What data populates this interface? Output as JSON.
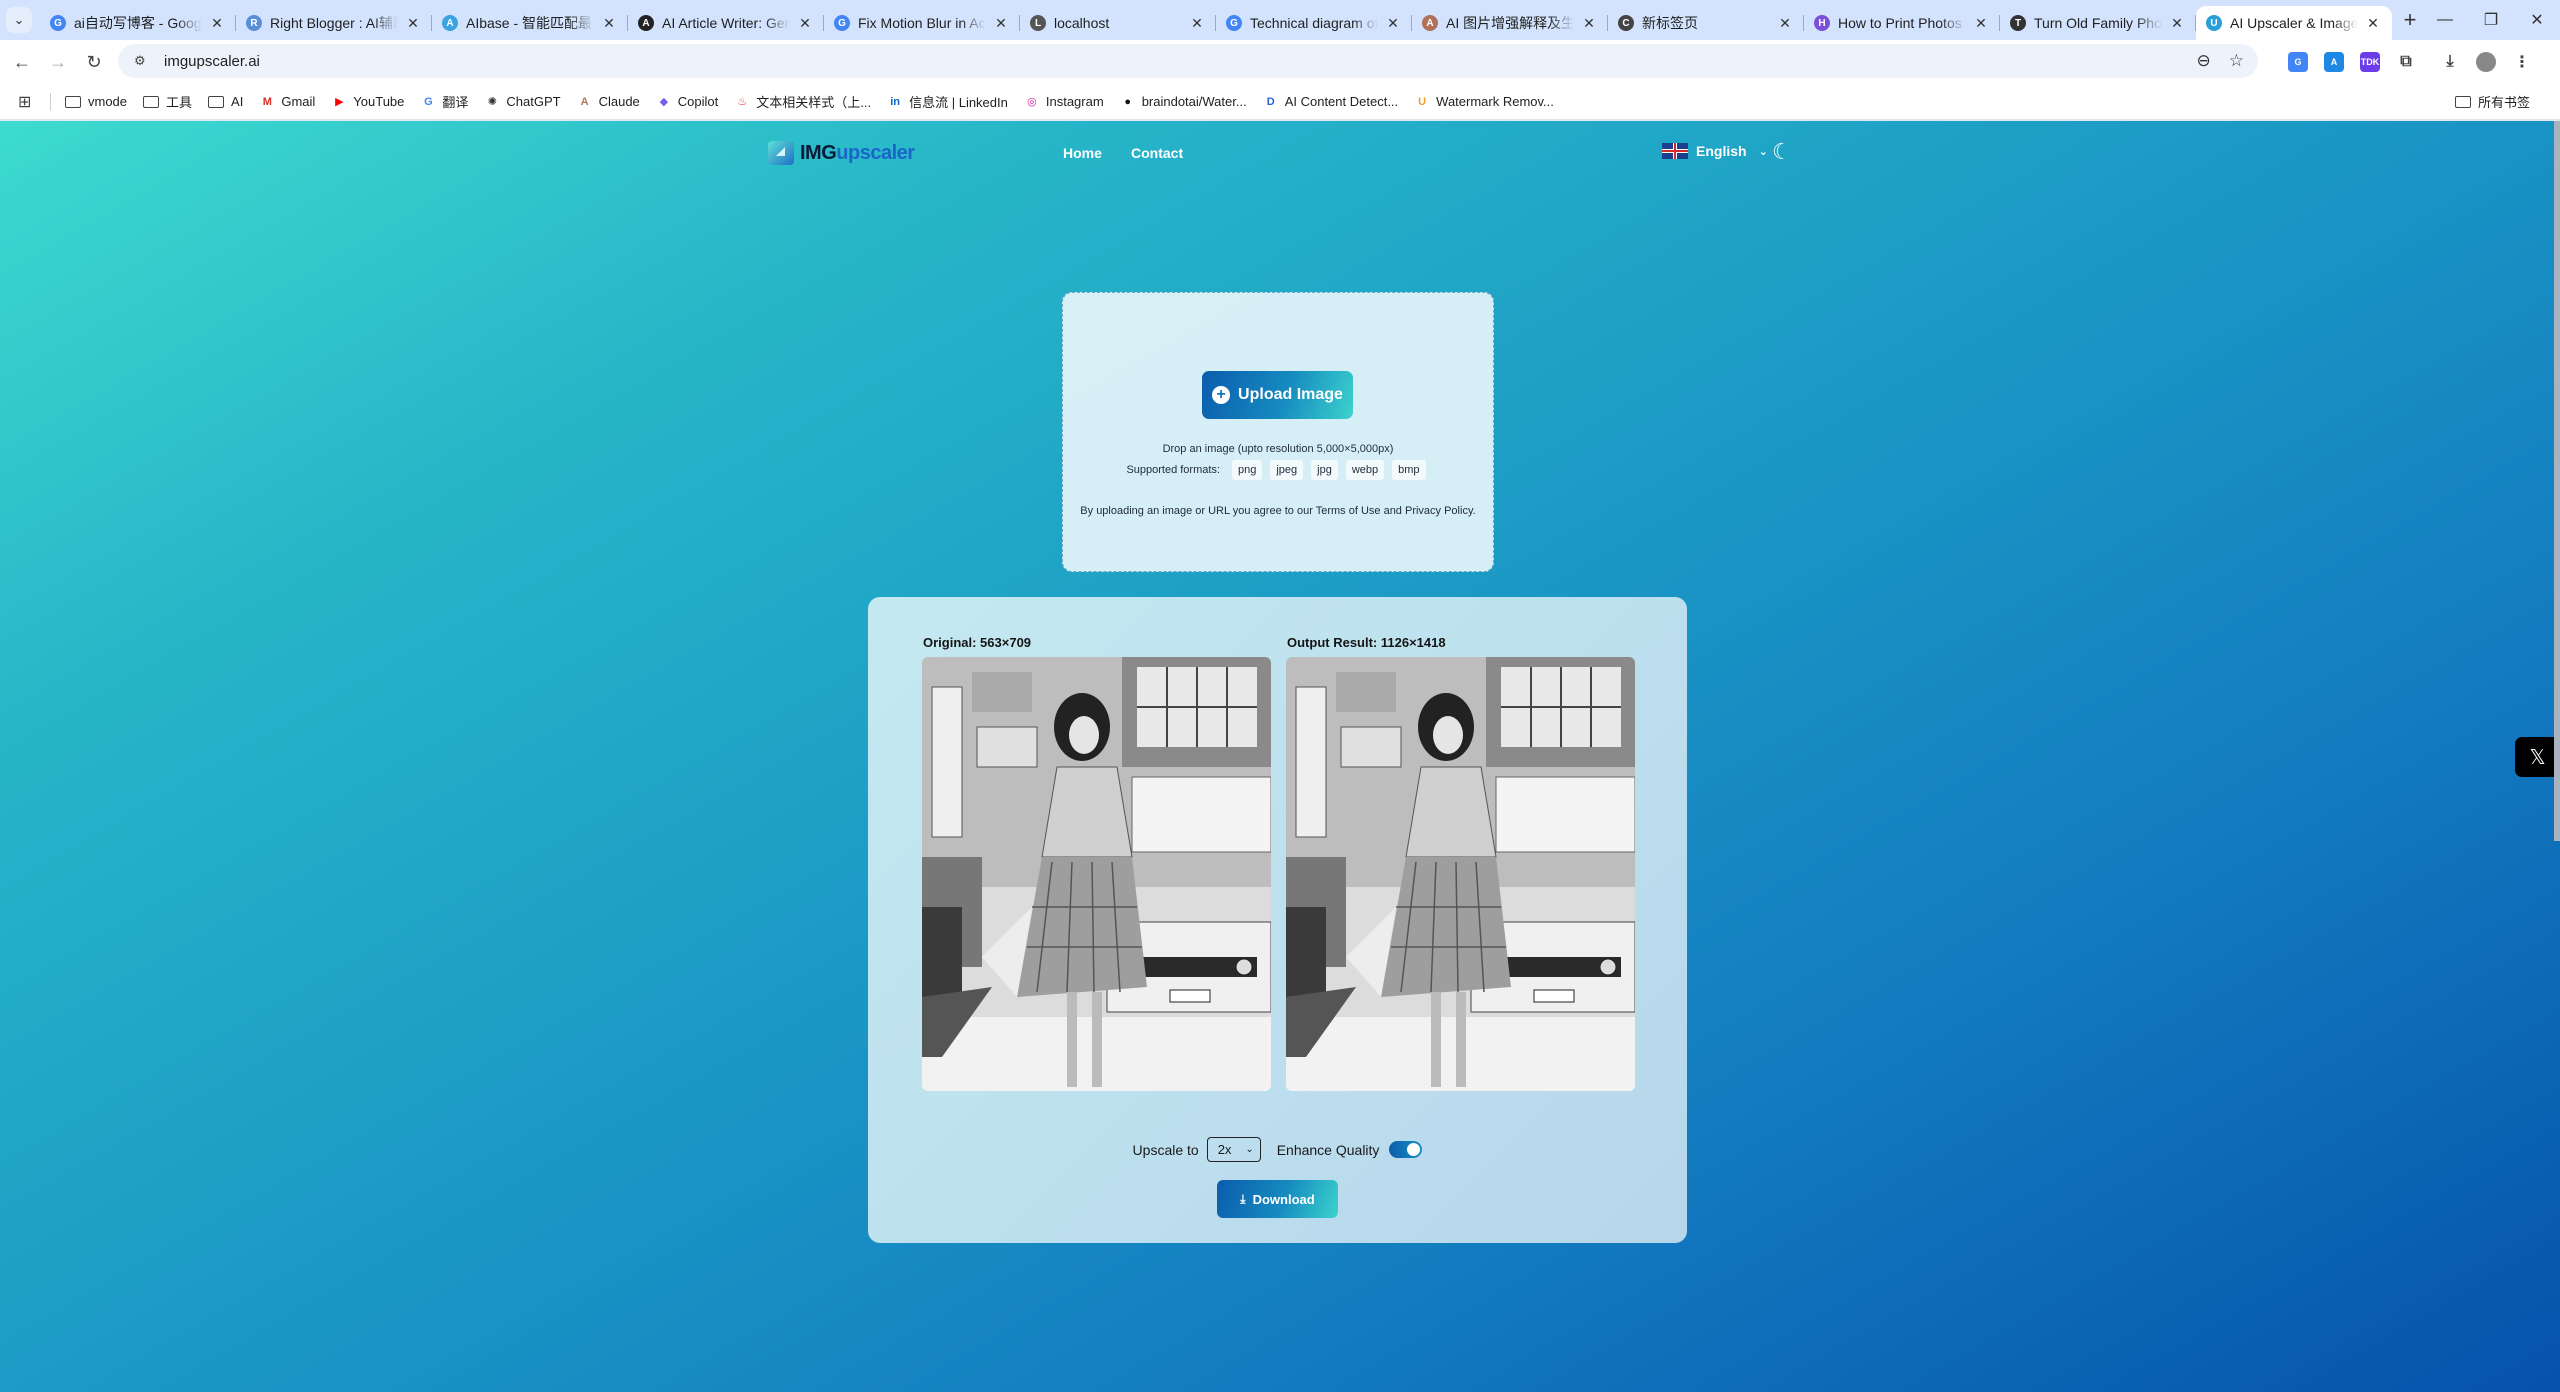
{
  "browser": {
    "tabs": [
      {
        "title": "ai自动写博客 - Google",
        "favicon": "G",
        "color": "#4285f4"
      },
      {
        "title": "Right Blogger : AI辅助",
        "favicon": "R",
        "color": "#5a8fd8"
      },
      {
        "title": "AIbase - 智能匹配最适",
        "favicon": "A",
        "color": "#3aa3e0"
      },
      {
        "title": "AI Article Writer: Gen",
        "favicon": "A",
        "color": "#222"
      },
      {
        "title": "Fix Motion Blur in Ac",
        "favicon": "G",
        "color": "#4285f4"
      },
      {
        "title": "localhost",
        "favicon": "L",
        "color": "#555"
      },
      {
        "title": "Technical diagram of",
        "favicon": "G",
        "color": "#4285f4"
      },
      {
        "title": "AI 图片增强解释及生成",
        "favicon": "A",
        "color": "#b0705a"
      },
      {
        "title": "新标签页",
        "favicon": "C",
        "color": "#444"
      },
      {
        "title": "How to Print Photos",
        "favicon": "H",
        "color": "#7b4fd8"
      },
      {
        "title": "Turn Old Family Phot",
        "favicon": "T",
        "color": "#333"
      },
      {
        "title": "AI Upscaler & Image",
        "favicon": "U",
        "color": "#2a9fd6",
        "active": true
      }
    ],
    "url": "imgupscaler.ai",
    "bookmarks": [
      {
        "label": "vmode",
        "type": "folder"
      },
      {
        "label": "工具",
        "type": "folder"
      },
      {
        "label": "AI",
        "type": "folder"
      },
      {
        "label": "Gmail",
        "icon": "M",
        "color": "#d93025"
      },
      {
        "label": "YouTube",
        "icon": "▶",
        "color": "#ff0000"
      },
      {
        "label": "翻译",
        "icon": "G",
        "color": "#4285f4"
      },
      {
        "label": "ChatGPT",
        "icon": "✺",
        "color": "#333"
      },
      {
        "label": "Claude",
        "icon": "A",
        "color": "#b07a5a"
      },
      {
        "label": "Copilot",
        "icon": "◆",
        "color": "#7b5cf0"
      },
      {
        "label": "文本相关样式（上...",
        "icon": "♨",
        "color": "#e53935"
      },
      {
        "label": "信息流 | LinkedIn",
        "icon": "in",
        "color": "#0a66c2"
      },
      {
        "label": "Instagram",
        "icon": "◎",
        "color": "#d6249f"
      },
      {
        "label": "braindotai/Water...",
        "icon": "●",
        "color": "#111"
      },
      {
        "label": "AI Content Detect...",
        "icon": "D",
        "color": "#2a62d6"
      },
      {
        "label": "Watermark Remov...",
        "icon": "U",
        "color": "#f0a030"
      }
    ],
    "all_bookmarks": "所有书签"
  },
  "site": {
    "logo_prefix": "IMG",
    "logo_suffix": "upscaler",
    "nav": [
      "Home",
      "Contact"
    ],
    "language": "English"
  },
  "upload": {
    "button_label": "Upload Image",
    "drop_text": "Drop an image (upto resolution 5,000×5,000px)",
    "formats_label": "Supported formats:",
    "formats": [
      "png",
      "jpeg",
      "jpg",
      "webp",
      "bmp"
    ],
    "terms": "By uploading an image or URL you agree to our Terms of Use and Privacy Policy."
  },
  "result": {
    "original_label": "Original: 563×709",
    "output_label": "Output Result: 1126×1418",
    "upscale_label": "Upscale to",
    "upscale_value": "2x",
    "enhance_label": "Enhance Quality",
    "enhance_on": true,
    "download_label": "Download"
  },
  "colors": {
    "accent_start": "#0b5cad",
    "accent_end": "#3cd3cd"
  }
}
